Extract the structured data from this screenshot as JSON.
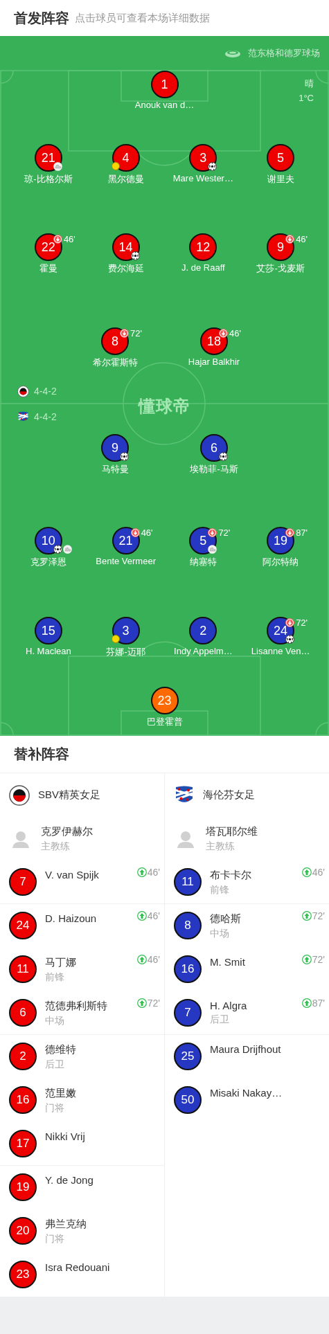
{
  "header": {
    "title": "首发阵容",
    "subtitle": "点击球员可查看本场详细数据"
  },
  "pitch": {
    "stadium": "范东格和德罗球场",
    "weather": "晴",
    "temperature": "1°C",
    "logo_text": "懂球帝",
    "home_rows": [
      [
        {
          "number": "1",
          "name": "Anouk van d…",
          "color": "#ee0000",
          "captain": false,
          "goal": false,
          "assist": false
        }
      ],
      [
        {
          "number": "21",
          "name": "琼-比格尔斯",
          "color": "#ee0000",
          "captain": false,
          "goal": false,
          "assist": true
        },
        {
          "number": "4",
          "name": "黑尔德曼",
          "color": "#ee0000",
          "captain": true,
          "goal": false,
          "assist": false
        },
        {
          "number": "3",
          "name": "Mare Wester…",
          "color": "#ee0000",
          "captain": false,
          "goal": true,
          "assist": false
        },
        {
          "number": "5",
          "name": "谢里夫",
          "color": "#ee0000",
          "captain": false,
          "goal": false,
          "assist": false
        }
      ],
      [
        {
          "number": "22",
          "name": "霍曼",
          "color": "#ee0000",
          "captain": false,
          "goal": false,
          "assist": false,
          "sub_off": "46'"
        },
        {
          "number": "14",
          "name": "费尔海延",
          "color": "#ee0000",
          "captain": false,
          "goal": true,
          "assist": false
        },
        {
          "number": "12",
          "name": "J. de Raaff",
          "color": "#ee0000",
          "captain": false,
          "goal": false,
          "assist": false
        },
        {
          "number": "9",
          "name": "艾莎-戈麦斯",
          "color": "#ee0000",
          "captain": false,
          "goal": false,
          "assist": false,
          "sub_off": "46'"
        }
      ],
      [
        {
          "number": "8",
          "name": "希尔霍斯特",
          "color": "#ee0000",
          "captain": false,
          "goal": false,
          "assist": false,
          "sub_off": "72'"
        },
        {
          "number": "18",
          "name": "Hajar Balkhir",
          "color": "#ee0000",
          "captain": false,
          "goal": false,
          "assist": false,
          "sub_off": "46'"
        }
      ]
    ],
    "formations": [
      {
        "kind": "home",
        "text": "4-4-2"
      },
      {
        "kind": "away",
        "text": "4-4-2"
      }
    ],
    "away_rows": [
      [
        {
          "number": "9",
          "name": "马特曼",
          "color": "#2638c2",
          "captain": false,
          "goal": true,
          "assist": false
        },
        {
          "number": "6",
          "name": "埃勒菲-马斯",
          "color": "#2638c2",
          "captain": false,
          "goal": true,
          "assist": false
        }
      ],
      [
        {
          "number": "10",
          "name": "克罗泽恩",
          "color": "#2638c2",
          "captain": false,
          "goal": true,
          "assist": true
        },
        {
          "number": "21",
          "name": "Bente Vermeer",
          "color": "#2638c2",
          "captain": false,
          "goal": false,
          "assist": false,
          "sub_off": "46'"
        },
        {
          "number": "5",
          "name": "纳塞特",
          "color": "#2638c2",
          "captain": false,
          "goal": false,
          "assist": true,
          "sub_off": "72'"
        },
        {
          "number": "19",
          "name": "阿尔特纳",
          "color": "#2638c2",
          "captain": false,
          "goal": false,
          "assist": false,
          "sub_off": "87'"
        }
      ],
      [
        {
          "number": "15",
          "name": "H. Maclean",
          "color": "#2638c2",
          "captain": false,
          "goal": false,
          "assist": false
        },
        {
          "number": "3",
          "name": "芬娜-迈耶",
          "color": "#2638c2",
          "captain": true,
          "goal": false,
          "assist": false
        },
        {
          "number": "2",
          "name": "Indy Appelm…",
          "color": "#2638c2",
          "captain": false,
          "goal": false,
          "assist": false
        },
        {
          "number": "24",
          "name": "Lisanne Ven…",
          "color": "#2638c2",
          "captain": false,
          "goal": true,
          "assist": false,
          "sub_off": "72'"
        }
      ],
      [
        {
          "number": "23",
          "name": "巴登霍普",
          "color": "#ff6a00",
          "captain": false,
          "goal": false,
          "assist": false
        }
      ]
    ]
  },
  "subs": {
    "title": "替补阵容",
    "teams": [
      {
        "kind": "home",
        "name": "SBV精英女足",
        "coach": {
          "name": "克罗伊赫尔",
          "role": "主教练"
        },
        "players": [
          {
            "number": "7",
            "name": "V. van Spijk",
            "color": "#ee0000",
            "sub_on": "46'"
          },
          {
            "number": "24",
            "name": "D. Haizoun",
            "color": "#ee0000",
            "sub_on": "46'"
          },
          {
            "number": "11",
            "name": "马丁娜",
            "position": "前锋",
            "color": "#ee0000",
            "sub_on": "46'"
          },
          {
            "number": "6",
            "name": "范德弗利斯特",
            "position": "中场",
            "color": "#ee0000",
            "sub_on": "72'"
          },
          {
            "number": "2",
            "name": "德维特",
            "position": "后卫",
            "color": "#ee0000"
          },
          {
            "number": "16",
            "name": "范里嫩",
            "position": "门将",
            "color": "#ee0000"
          },
          {
            "number": "17",
            "name": "Nikki Vrij",
            "color": "#ee0000"
          },
          {
            "number": "19",
            "name": "Y. de Jong",
            "color": "#ee0000"
          },
          {
            "number": "20",
            "name": "弗兰克纳",
            "position": "门将",
            "color": "#ee0000"
          },
          {
            "number": "23",
            "name": "Isra Redouani",
            "color": "#ee0000"
          }
        ]
      },
      {
        "kind": "away",
        "name": "海伦芬女足",
        "coach": {
          "name": "塔瓦耶尔维",
          "role": "主教练"
        },
        "players": [
          {
            "number": "11",
            "name": "布卡卡尔",
            "position": "前锋",
            "color": "#2638c2",
            "sub_on": "46'"
          },
          {
            "number": "8",
            "name": "德哈斯",
            "position": "中场",
            "color": "#2638c2",
            "sub_on": "72'"
          },
          {
            "number": "16",
            "name": "M. Smit",
            "color": "#2638c2",
            "sub_on": "72'"
          },
          {
            "number": "7",
            "name": "H. Algra",
            "position": "后卫",
            "color": "#2638c2",
            "sub_on": "87'"
          },
          {
            "number": "25",
            "name": "Maura Drijfhout",
            "color": "#2638c2"
          },
          {
            "number": "50",
            "name": "Misaki Nakay…",
            "color": "#2638c2"
          }
        ]
      }
    ]
  }
}
